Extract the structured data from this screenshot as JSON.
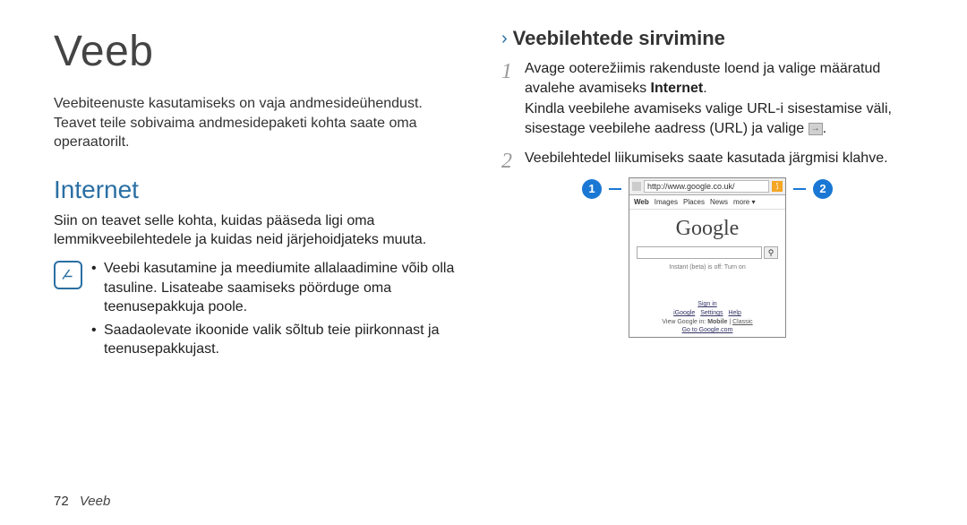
{
  "left": {
    "title": "Veeb",
    "intro": "Veebiteenuste kasutamiseks on vaja andmesideühendust. Teavet teile sobivaima andmesidepaketi kohta saate oma operaatorilt.",
    "section_heading": "Internet",
    "section_text": "Siin on teavet selle kohta, kuidas pääseda ligi oma lemmikveebilehtedele ja kuidas neid järjehoidjateks muuta.",
    "bullets": [
      "Veebi kasutamine ja meediumite allalaadimine võib olla tasuline. Lisateabe saamiseks pöörduge oma teenusepakkuja poole.",
      "Saadaolevate ikoonide valik sõltub teie piirkonnast ja teenusepakkujast."
    ]
  },
  "right": {
    "subheading": "Veebilehtede sirvimine",
    "steps": [
      {
        "num": "1",
        "text_a": "Avage ooterežiimis rakenduste loend ja valige määratud avalehe avamiseks ",
        "bold": "Internet",
        "text_b": ".",
        "extra": "Kindla veebilehe avamiseks valige URL-i sisestamise väli, sisestage veebilehe aadress (URL) ja valige ",
        "has_icon": true,
        "text_c": "."
      },
      {
        "num": "2",
        "text_a": "Veebilehtedel liikumiseks saate kasutada järgmisi klahve.",
        "bold": "",
        "text_b": "",
        "extra": "",
        "has_icon": false,
        "text_c": ""
      }
    ],
    "callouts": {
      "left": "1",
      "right": "2"
    },
    "phone": {
      "url": "http://www.google.co.uk/",
      "tabs": [
        "Web",
        "Images",
        "Places",
        "News",
        "more ▾"
      ],
      "logo": "Google",
      "search_btn": "⚲",
      "instant": "Instant (beta) is off: Turn on",
      "signin": "Sign in",
      "links": [
        "iGoogle",
        "Settings",
        "Help"
      ],
      "view_prefix": "View Google in: ",
      "view_bold": "Mobile",
      "view_sep": " | ",
      "view_link": "Classic",
      "goto": "Go to Google.com"
    }
  },
  "footer": {
    "page": "72",
    "title": "Veeb"
  }
}
